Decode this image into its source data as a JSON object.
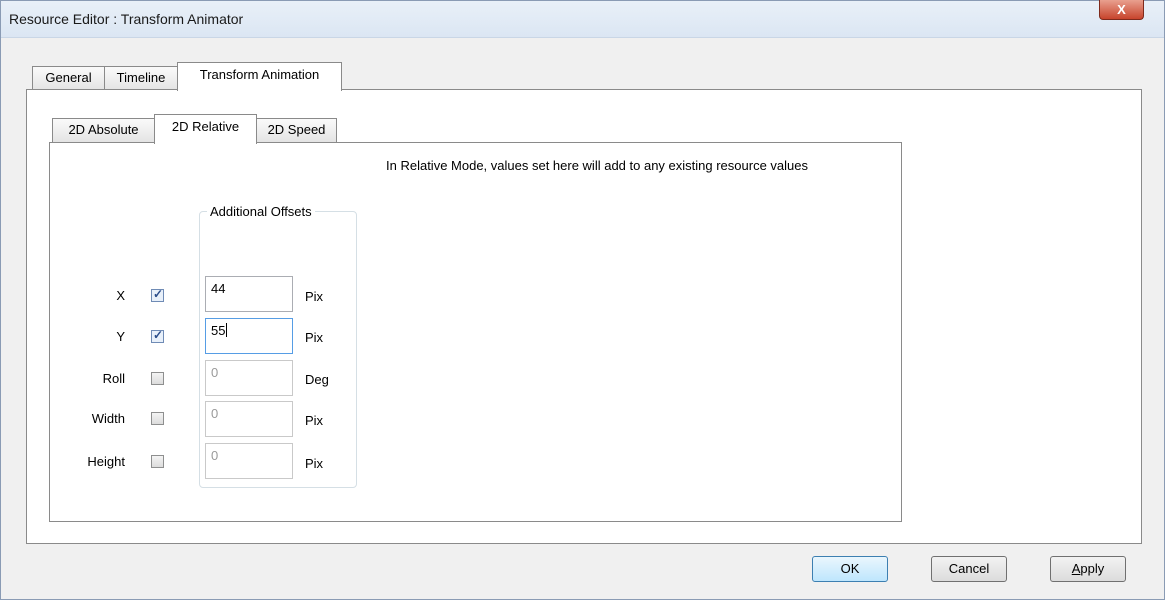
{
  "window": {
    "title": "Resource Editor  :  Transform Animator",
    "close_glyph": "X"
  },
  "outer_tabs": [
    {
      "label": "General",
      "active": false
    },
    {
      "label": "Timeline",
      "active": false
    },
    {
      "label": "Transform Animation",
      "active": true
    }
  ],
  "inner_tabs": [
    {
      "label": "2D Absolute",
      "active": false
    },
    {
      "label": "2D Relative",
      "active": true
    },
    {
      "label": "2D Speed",
      "active": false
    }
  ],
  "info_text": "In Relative Mode, values set here will add to any existing resource values",
  "offsets": {
    "group_title": "Additional Offsets",
    "rows": [
      {
        "label": "X",
        "checked": true,
        "value": "44",
        "unit": "Pix",
        "enabled": true
      },
      {
        "label": "Y",
        "checked": true,
        "value": "55",
        "unit": "Pix",
        "enabled": true
      },
      {
        "label": "Roll",
        "checked": false,
        "value": "0",
        "unit": "Deg",
        "enabled": false
      },
      {
        "label": "Width",
        "checked": false,
        "value": "0",
        "unit": "Pix",
        "enabled": false
      },
      {
        "label": "Height",
        "checked": false,
        "value": "0",
        "unit": "Pix",
        "enabled": false
      }
    ]
  },
  "buttons": {
    "ok": "OK",
    "cancel": "Cancel",
    "apply_first": "A",
    "apply_rest": "pply"
  }
}
